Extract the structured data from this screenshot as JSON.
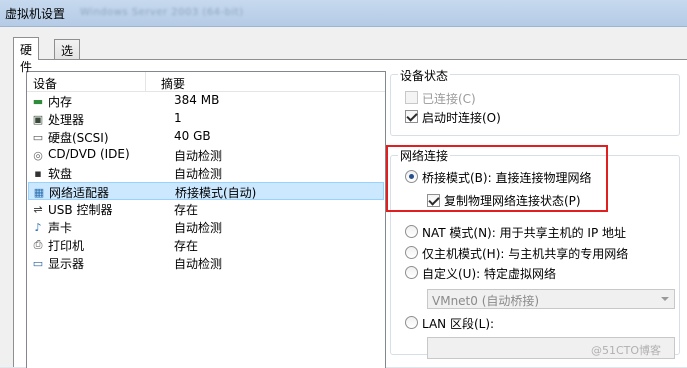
{
  "window": {
    "title": "虚拟机设置",
    "blurred_text": "Windows Server 2003 (64-bit)"
  },
  "tabs": [
    {
      "label": "硬件",
      "active": true
    },
    {
      "label": "选项",
      "active": false
    }
  ],
  "device_list": {
    "headers": {
      "device": "设备",
      "summary": "摘要"
    },
    "rows": [
      {
        "icon": "memory-icon",
        "name": "内存",
        "summary": "384 MB",
        "selected": false
      },
      {
        "icon": "processor-icon",
        "name": "处理器",
        "summary": "1",
        "selected": false
      },
      {
        "icon": "hard-disk-icon",
        "name": "硬盘(SCSI)",
        "summary": "40 GB",
        "selected": false
      },
      {
        "icon": "cd-dvd-icon",
        "name": "CD/DVD (IDE)",
        "summary": "自动检测",
        "selected": false
      },
      {
        "icon": "floppy-icon",
        "name": "软盘",
        "summary": "自动检测",
        "selected": false
      },
      {
        "icon": "network-adapter-icon",
        "name": "网络适配器",
        "summary": "桥接模式(自动)",
        "selected": true
      },
      {
        "icon": "usb-controller-icon",
        "name": "USB 控制器",
        "summary": "存在",
        "selected": false
      },
      {
        "icon": "sound-card-icon",
        "name": "声卡",
        "summary": "自动检测",
        "selected": false
      },
      {
        "icon": "printer-icon",
        "name": "打印机",
        "summary": "存在",
        "selected": false
      },
      {
        "icon": "display-icon",
        "name": "显示器",
        "summary": "自动检测",
        "selected": false
      }
    ]
  },
  "device_status": {
    "title": "设备状态",
    "connected": {
      "label": "已连接(C)",
      "checked": false,
      "enabled": false
    },
    "connect_on_power": {
      "label": "启动时连接(O)",
      "checked": true,
      "enabled": true
    }
  },
  "network_connection": {
    "title": "网络连接",
    "bridged": {
      "label": "桥接模式(B): 直接连接物理网络",
      "selected": true
    },
    "replicate_state": {
      "label": "复制物理网络连接状态(P)",
      "checked": true
    },
    "nat": {
      "label": "NAT 模式(N): 用于共享主机的 IP 地址",
      "selected": false
    },
    "host_only": {
      "label": "仅主机模式(H): 与主机共享的专用网络",
      "selected": false
    },
    "custom": {
      "label": "自定义(U): 特定虚拟网络",
      "selected": false
    },
    "custom_select_value": "VMnet0 (自动桥接)",
    "lan_segment": {
      "label": "LAN 区段(L):",
      "selected": false
    },
    "lan_segment_value": ""
  },
  "watermark": "@51CTO博客",
  "colors": {
    "highlight_border": "#e02020",
    "selection_bg": "#cce8ff"
  }
}
